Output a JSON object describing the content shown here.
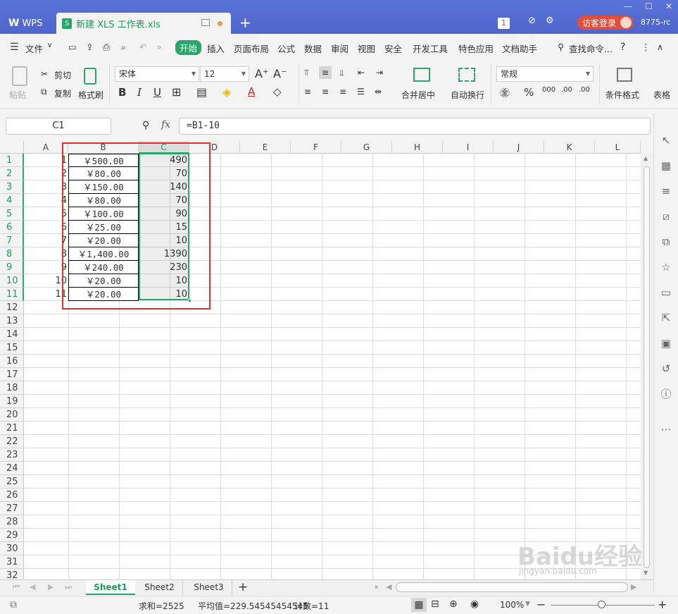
{
  "titlebar": {
    "app_tab": "WPS",
    "doc_tab": "新建 XLS 工作表.xls",
    "doc_icon": "S",
    "add_tab": "+",
    "badge_count": "1",
    "login_label": "访客登录",
    "user_id": "8775-rc"
  },
  "menu": {
    "file": "文件",
    "items": [
      "开始",
      "插入",
      "页面布局",
      "公式",
      "数据",
      "审阅",
      "视图",
      "安全",
      "开发工具",
      "特色应用",
      "文档助手"
    ],
    "search": "查找命令...",
    "help": "?"
  },
  "toolbar": {
    "paste": "粘贴",
    "cut": "剪切",
    "copy": "复制",
    "format_painter": "格式刷",
    "font_name": "宋体",
    "font_size": "12",
    "bold": "B",
    "italic": "I",
    "underline": "U",
    "merge_center": "合并居中",
    "wrap_text": "自动换行",
    "number_format": "常规",
    "conditional_format": "条件格式",
    "table_style": "表格"
  },
  "formula_bar": {
    "name_box": "C1",
    "fx": "fx",
    "formula": "=B1-10"
  },
  "grid": {
    "columns": [
      "A",
      "B",
      "C",
      "D",
      "E",
      "F",
      "G",
      "H",
      "I",
      "J",
      "K",
      "L"
    ],
    "rows": [
      "1",
      "2",
      "3",
      "4",
      "5",
      "6",
      "7",
      "8",
      "9",
      "10",
      "11",
      "12",
      "13",
      "14",
      "15",
      "16",
      "17",
      "18",
      "19",
      "20",
      "21",
      "22",
      "23",
      "24",
      "25",
      "26",
      "27",
      "28",
      "29",
      "30",
      "31",
      "32"
    ],
    "col_a": [
      "1",
      "2",
      "3",
      "4",
      "5",
      "6",
      "7",
      "8",
      "9",
      "10",
      "11"
    ],
    "col_b": [
      "￥500.00",
      "￥80.00",
      "￥150.00",
      "￥80.00",
      "￥100.00",
      "￥25.00",
      "￥20.00",
      "￥1,400.00",
      "￥240.00",
      "￥20.00",
      "￥20.00"
    ],
    "col_c": [
      "490",
      "70",
      "140",
      "70",
      "90",
      "15",
      "10",
      "1390",
      "230",
      "10",
      "10"
    ]
  },
  "sheets": [
    "Sheet1",
    "Sheet2",
    "Sheet3"
  ],
  "status": {
    "sum": "求和=2525",
    "average": "平均值=229.54545454545",
    "count": "计数=11",
    "zoom": "100%"
  },
  "watermark": {
    "logo": "Baidu经验",
    "url": "jingyan.baidu.com"
  }
}
